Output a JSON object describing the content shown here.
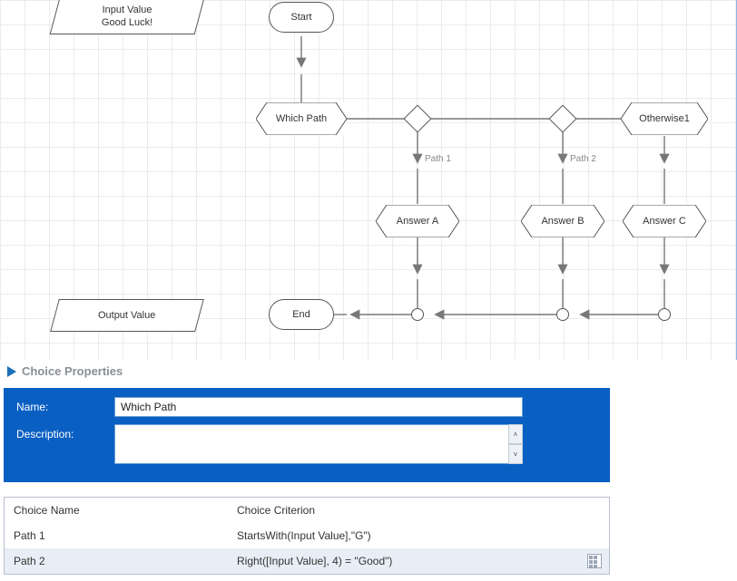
{
  "flow": {
    "input_value_label": "Input Value\nGood Luck!",
    "output_value_label": "Output Value",
    "start": "Start",
    "end": "End",
    "decision": "Which Path",
    "otherwise": "Otherwise1",
    "answers": {
      "a": "Answer A",
      "b": "Answer B",
      "c": "Answer C"
    },
    "paths": {
      "p1": "Path 1",
      "p2": "Path 2"
    }
  },
  "panel": {
    "title": "Choice Properties",
    "name_label": "Name:",
    "name_value": "Which Path",
    "desc_label": "Description:",
    "desc_value": ""
  },
  "table": {
    "headers": {
      "name": "Choice Name",
      "criterion": "Choice Criterion"
    },
    "rows": [
      {
        "name": "Path 1",
        "criterion": "StartsWith(Input Value],\"G\")"
      },
      {
        "name": "Path 2",
        "criterion": "Right([Input Value], 4) = \"Good\")"
      }
    ]
  }
}
